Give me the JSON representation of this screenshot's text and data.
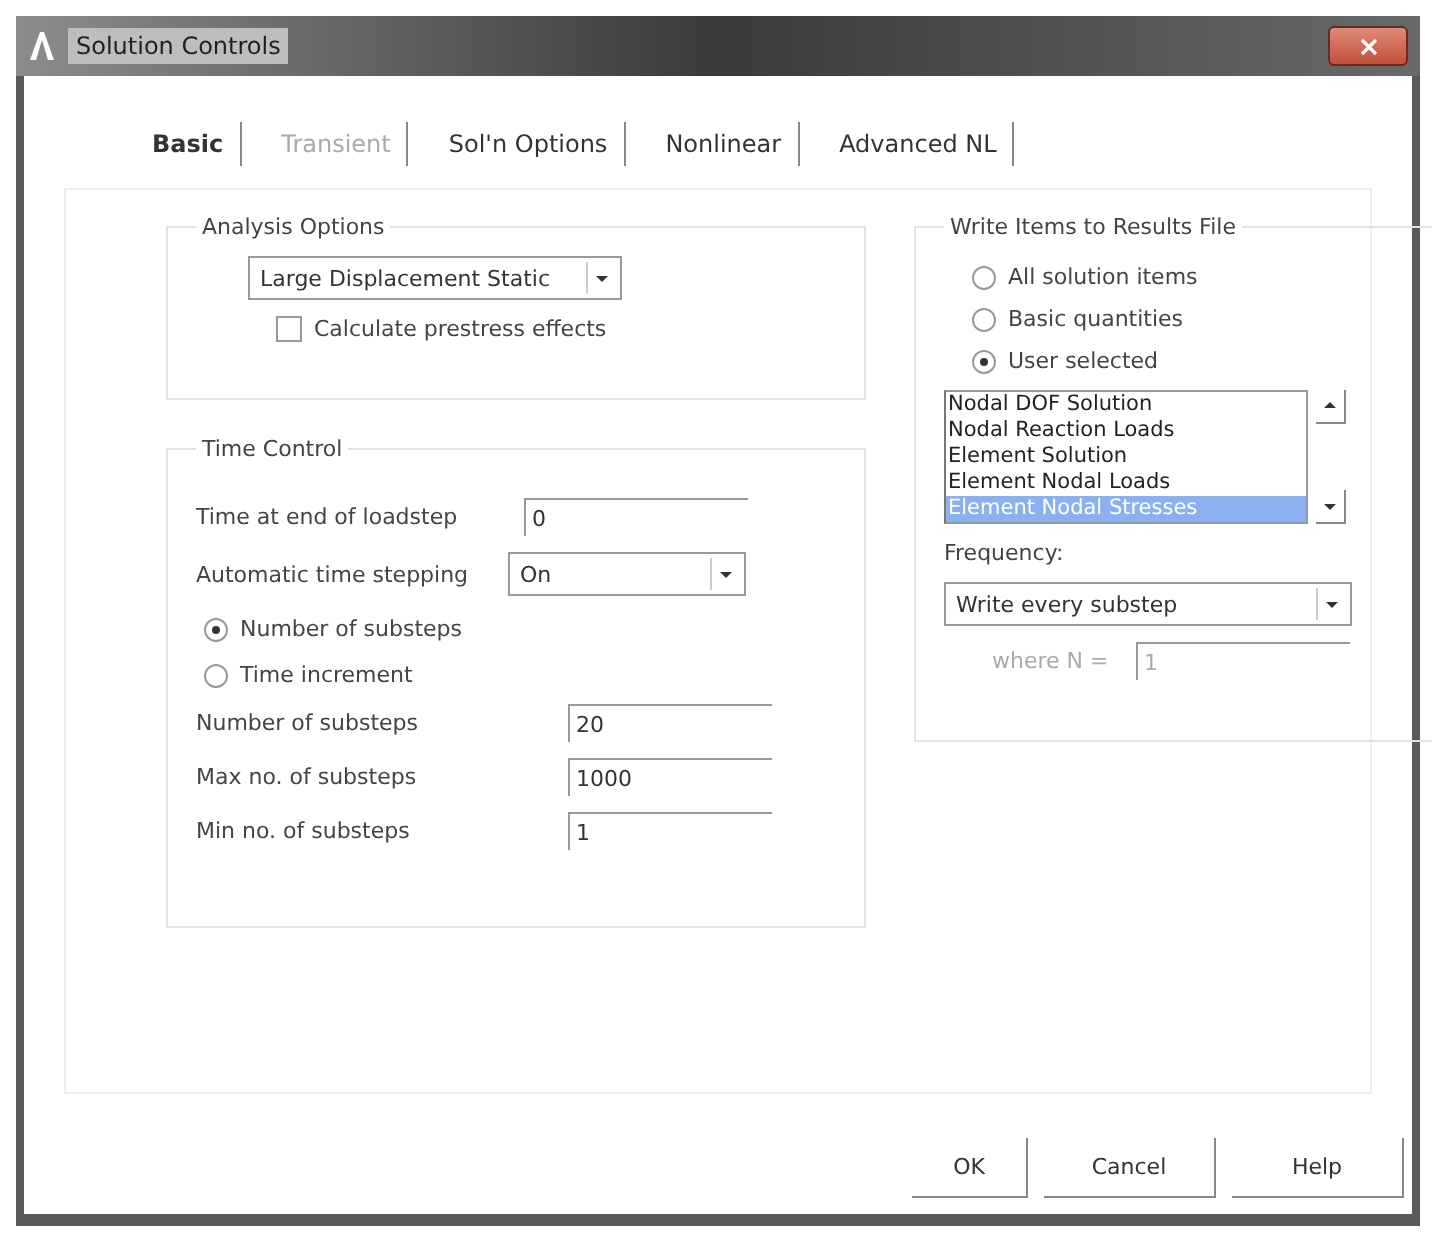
{
  "window": {
    "title": "Solution Controls"
  },
  "tabs": [
    {
      "label": "Basic",
      "selected": true,
      "disabled": false
    },
    {
      "label": "Transient",
      "selected": false,
      "disabled": true
    },
    {
      "label": "Sol'n Options",
      "selected": false,
      "disabled": false
    },
    {
      "label": "Nonlinear",
      "selected": false,
      "disabled": false
    },
    {
      "label": "Advanced NL",
      "selected": false,
      "disabled": false
    }
  ],
  "analysis_options": {
    "title": "Analysis Options",
    "analysis_type": "Large Displacement Static",
    "prestress": {
      "label": "Calculate prestress effects",
      "checked": false
    }
  },
  "time_control": {
    "title": "Time Control",
    "end_time": {
      "label": "Time at end of loadstep",
      "value": "0"
    },
    "auto_stepping": {
      "label": "Automatic time stepping",
      "value": "On"
    },
    "step_mode": [
      {
        "label": "Number of substeps",
        "selected": true
      },
      {
        "label": "Time increment",
        "selected": false
      }
    ],
    "fields": [
      {
        "label": "Number of substeps",
        "value": "20"
      },
      {
        "label": "Max no. of substeps",
        "value": "1000"
      },
      {
        "label": "Min no. of substeps",
        "value": "1"
      }
    ]
  },
  "results_file": {
    "title": "Write Items to Results File",
    "options": [
      {
        "label": "All solution items",
        "selected": false
      },
      {
        "label": "Basic quantities",
        "selected": false
      },
      {
        "label": "User selected",
        "selected": true
      }
    ],
    "items": [
      {
        "label": "Nodal DOF Solution",
        "selected": false
      },
      {
        "label": "Nodal Reaction Loads",
        "selected": false
      },
      {
        "label": "Element Solution",
        "selected": false
      },
      {
        "label": "Element Nodal Loads",
        "selected": false
      },
      {
        "label": "Element Nodal Stresses",
        "selected": true
      }
    ],
    "frequency_label": "Frequency:",
    "frequency": "Write every substep",
    "n_label": "where N =",
    "n_value": "1"
  },
  "buttons": [
    "OK",
    "Cancel",
    "Help"
  ]
}
